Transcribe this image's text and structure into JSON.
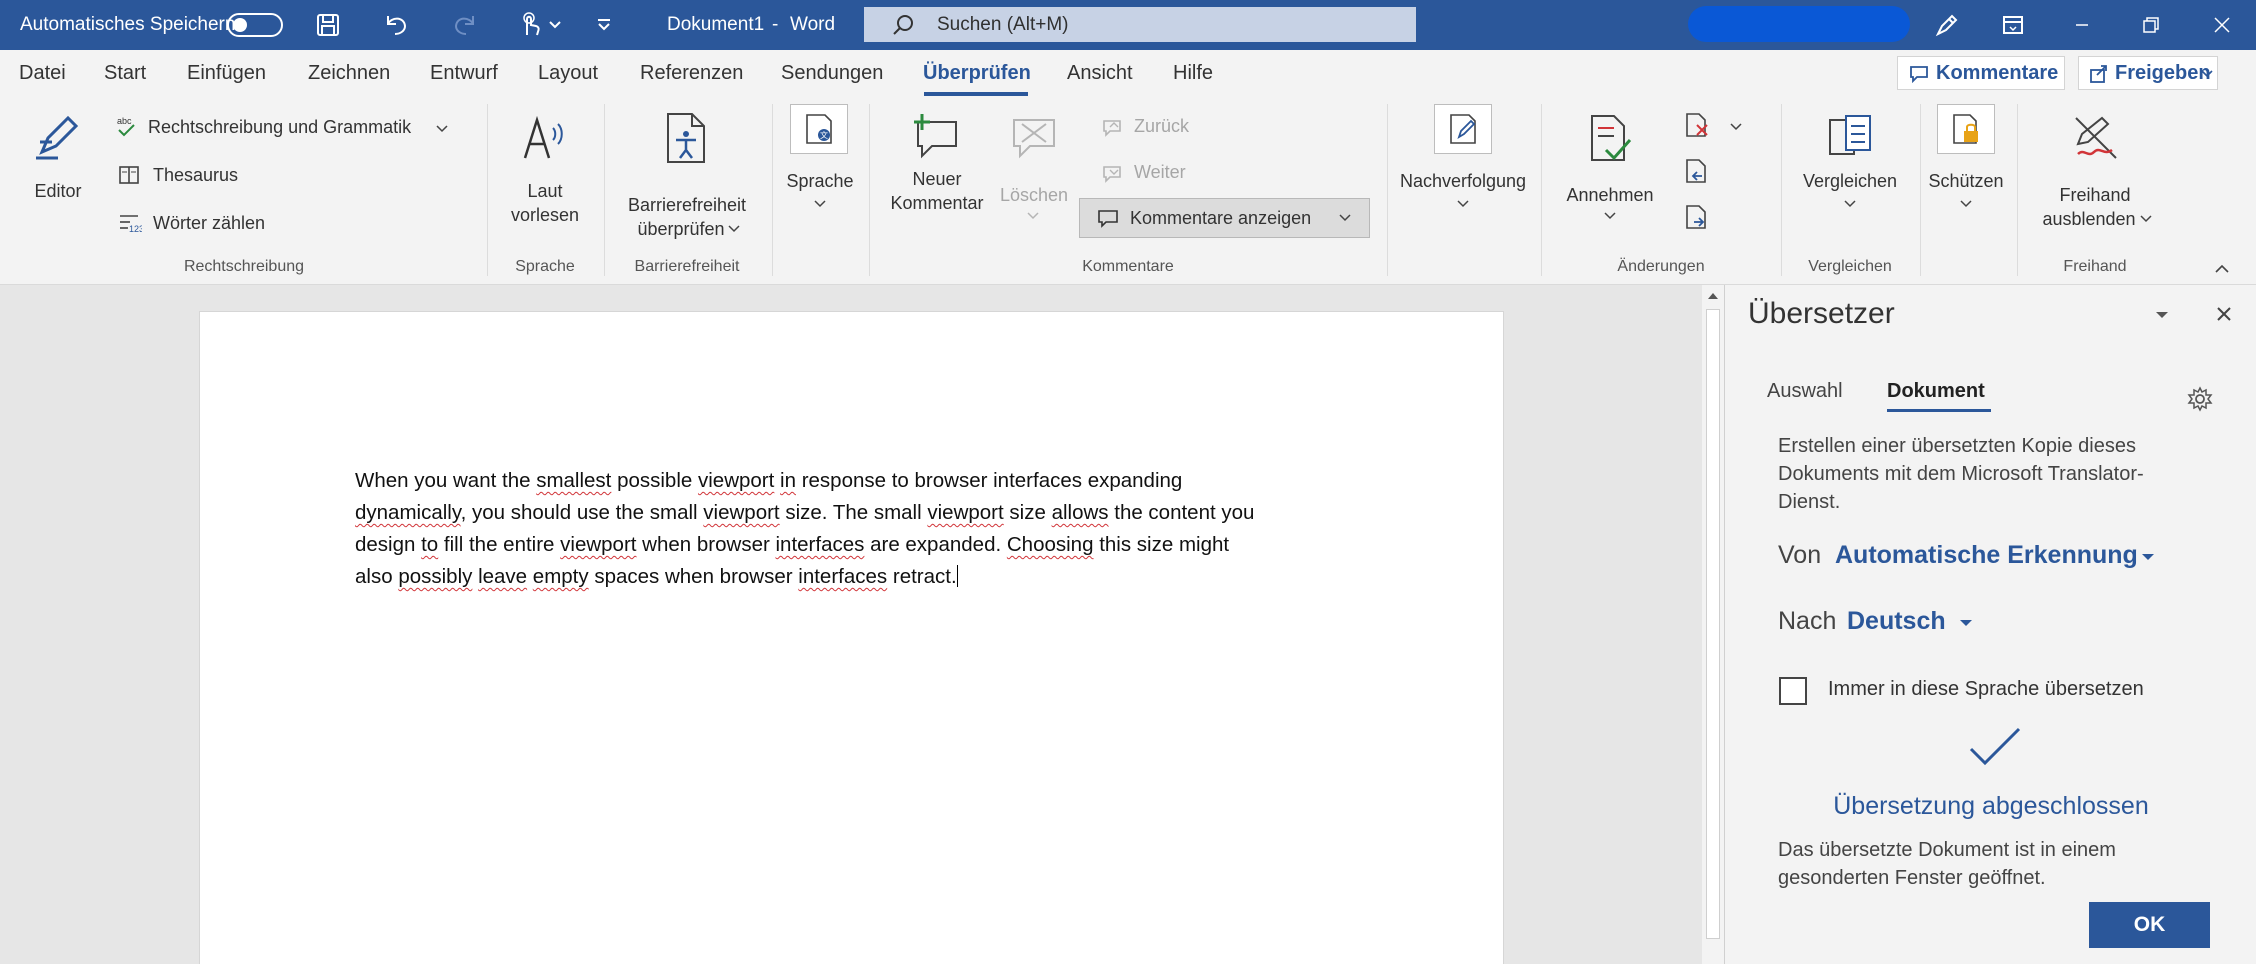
{
  "titlebar": {
    "autosave_label": "Automatisches Speichern",
    "doc_title": "Dokument1",
    "separator": "-",
    "app_name": "Word",
    "search_placeholder": "Suchen (Alt+M)"
  },
  "menu": {
    "tabs": [
      "Datei",
      "Start",
      "Einfügen",
      "Zeichnen",
      "Entwurf",
      "Layout",
      "Referenzen",
      "Sendungen",
      "Überprüfen",
      "Ansicht",
      "Hilfe"
    ],
    "active_tab": "Überprüfen",
    "comments_button": "Kommentare",
    "share_button": "Freigeben"
  },
  "ribbon": {
    "editor": "Editor",
    "spelling": "Rechtschreibung und Grammatik",
    "thesaurus": "Thesaurus",
    "wordcount": "Wörter zählen",
    "read_aloud": [
      "Laut",
      "vorlesen"
    ],
    "accessibility": [
      "Barrierefreiheit",
      "überprüfen"
    ],
    "language": "Sprache",
    "new_comment": [
      "Neuer",
      "Kommentar"
    ],
    "delete": "Löschen",
    "previous": "Zurück",
    "next": "Weiter",
    "show_comments": "Kommentare anzeigen",
    "tracking": "Nachverfolgung",
    "accept": "Annehmen",
    "compare": "Vergleichen",
    "protect": "Schützen",
    "ink": [
      "Freihand",
      "ausblenden"
    ],
    "groups": {
      "proofing": "Rechtschreibung",
      "speech": "Sprache",
      "accessibility": "Barrierefreiheit",
      "comments": "Kommentare",
      "changes": "Änderungen",
      "compare": "Vergleichen",
      "ink": "Freihand"
    }
  },
  "document": {
    "lines": [
      "When you want the smallest possible viewport in response to browser interfaces expanding",
      "dynamically, you should use the small viewport size. The small viewport size allows the content you",
      "design to fill the entire viewport when browser interfaces are expanded. Choosing this size might",
      "also possibly leave empty spaces when browser interfaces retract."
    ]
  },
  "translator": {
    "title": "Übersetzer",
    "tab_selection": "Auswahl",
    "tab_document": "Dokument",
    "description": [
      "Erstellen einer übersetzten Kopie dieses",
      "Dokuments mit dem Microsoft Translator-",
      "Dienst."
    ],
    "from_label": "Von",
    "from_value": "Automatische Erkennung",
    "to_label": "Nach",
    "to_value": "Deutsch",
    "always_translate": "Immer in diese Sprache übersetzen",
    "status": "Übersetzung abgeschlossen",
    "result": [
      "Das übersetzte Dokument ist in einem",
      "gesonderten Fenster geöffnet."
    ],
    "ok": "OK"
  },
  "colors": {
    "brand": "#2b579a",
    "ribbon_bg": "#f3f3f3",
    "squiggle": "#d13438"
  }
}
